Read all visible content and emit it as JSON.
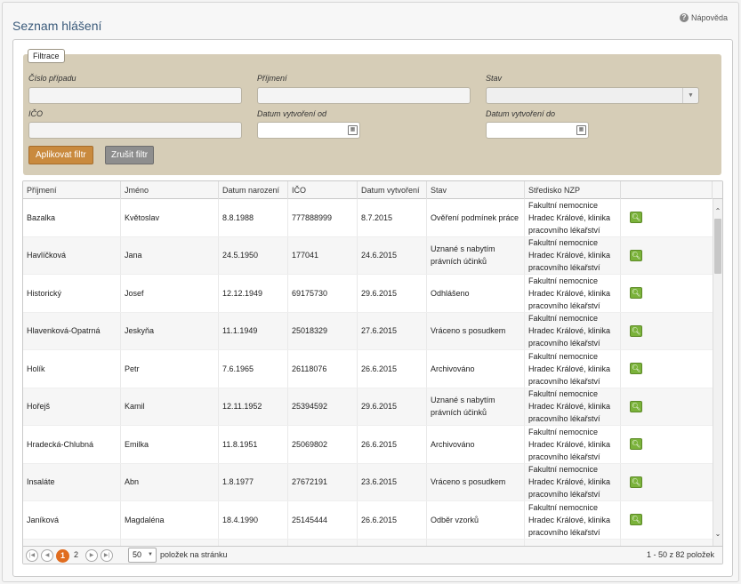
{
  "page": {
    "title": "Seznam hlášení",
    "help_label": "Nápověda"
  },
  "filter": {
    "legend": "Filtrace",
    "case_number_label": "Číslo případu",
    "surname_label": "Příjmení",
    "status_label": "Stav",
    "ico_label": "IČO",
    "created_from_label": "Datum vytvoření od",
    "created_to_label": "Datum vytvoření do",
    "case_number_value": "",
    "surname_value": "",
    "status_value": "",
    "ico_value": "",
    "created_from_value": "",
    "created_to_value": "",
    "apply_label": "Aplikovat filtr",
    "cancel_label": "Zrušit filtr"
  },
  "table": {
    "columns": [
      "Příjmení",
      "Jméno",
      "Datum narození",
      "IČO",
      "Datum vytvoření",
      "Stav",
      "Středisko NZP"
    ],
    "rows": [
      {
        "prijmeni": "Bazalka",
        "jmeno": "Květoslav",
        "narozeni": "8.8.1988",
        "ico": "777888999",
        "vytvoreni": "8.7.2015",
        "stav": "Ověření podmínek práce",
        "stredisko": "Fakultní nemocnice Hradec Králové, klinika pracovního lékařství"
      },
      {
        "prijmeni": "Havlíčková",
        "jmeno": "Jana",
        "narozeni": "24.5.1950",
        "ico": "177041",
        "vytvoreni": "24.6.2015",
        "stav": "Uznané s nabytím právních účinků",
        "stredisko": "Fakultní nemocnice Hradec Králové, klinika pracovního lékařství"
      },
      {
        "prijmeni": "Historický",
        "jmeno": "Josef",
        "narozeni": "12.12.1949",
        "ico": "69175730",
        "vytvoreni": "29.6.2015",
        "stav": "Odhlášeno",
        "stredisko": "Fakultní nemocnice Hradec Králové, klinika pracovního lékařství"
      },
      {
        "prijmeni": "Hlavenková-Opatrná",
        "jmeno": "Jeskyňa",
        "narozeni": "11.1.1949",
        "ico": "25018329",
        "vytvoreni": "27.6.2015",
        "stav": "Vráceno s posudkem",
        "stredisko": "Fakultní nemocnice Hradec Králové, klinika pracovního lékařství"
      },
      {
        "prijmeni": "Holík",
        "jmeno": "Petr",
        "narozeni": "7.6.1965",
        "ico": "26118076",
        "vytvoreni": "26.6.2015",
        "stav": "Archivováno",
        "stredisko": "Fakultní nemocnice Hradec Králové, klinika pracovního lékařství"
      },
      {
        "prijmeni": "Hořejš",
        "jmeno": "Kamil",
        "narozeni": "12.11.1952",
        "ico": "25394592",
        "vytvoreni": "29.6.2015",
        "stav": "Uznané s nabytím právních účinků",
        "stredisko": "Fakultní nemocnice Hradec Králové, klinika pracovního lékařství"
      },
      {
        "prijmeni": "Hradecká-Chlubná",
        "jmeno": "Emilka",
        "narozeni": "11.8.1951",
        "ico": "25069802",
        "vytvoreni": "26.6.2015",
        "stav": "Archivováno",
        "stredisko": "Fakultní nemocnice Hradec Králové, klinika pracovního lékařství"
      },
      {
        "prijmeni": "Insaláte",
        "jmeno": "Abn",
        "narozeni": "1.8.1977",
        "ico": "27672191",
        "vytvoreni": "23.6.2015",
        "stav": "Vráceno s posudkem",
        "stredisko": "Fakultní nemocnice Hradec Králové, klinika pracovního lékařství"
      },
      {
        "prijmeni": "Janíková",
        "jmeno": "Magdaléna",
        "narozeni": "18.4.1990",
        "ico": "25145444",
        "vytvoreni": "26.6.2015",
        "stav": "Odběr vzorků",
        "stredisko": "Fakultní nemocnice Hradec Králové, klinika pracovního lékařství"
      },
      {
        "prijmeni": "",
        "jmeno": "",
        "narozeni": "",
        "ico": "",
        "vytvoreni": "",
        "stav": "",
        "stredisko": "Fakultní nemocnice"
      }
    ]
  },
  "pager": {
    "pages": [
      "1",
      "2"
    ],
    "page_size": "50",
    "page_size_label": "položek na stránku",
    "info": "1 - 50 z 82 položek"
  },
  "icons": {
    "help": "help-icon",
    "calendar": "calendar-icon",
    "detail": "magnifier-icon"
  }
}
